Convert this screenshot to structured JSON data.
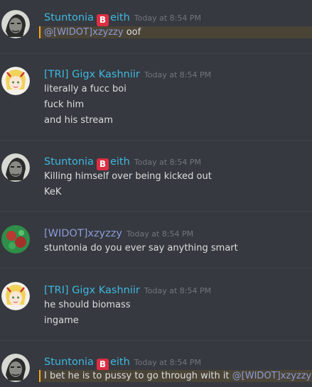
{
  "messages": [
    {
      "author": "Stuntonia",
      "author_suffix": "eith",
      "badge": "B",
      "name_color": "#3fb8e0",
      "timestamp": "Today at 8:54 PM",
      "avatar": "gritty-face-avatar",
      "lines": [
        {
          "mention": "@[WIDOT]xzyzzy",
          "text": " oof",
          "highlight": true
        }
      ]
    },
    {
      "author": "[TRI] Gigx Kashniir",
      "name_color": "#3fb8e0",
      "timestamp": "Today at 8:54 PM",
      "avatar": "anime-girl-avatar",
      "lines": [
        {
          "text": "literally a fucc boi"
        },
        {
          "text": "fuck him"
        },
        {
          "text": "and his stream"
        }
      ]
    },
    {
      "author": "Stuntonia",
      "author_suffix": "eith",
      "badge": "B",
      "name_color": "#3fb8e0",
      "timestamp": "Today at 8:54 PM",
      "avatar": "gritty-face-avatar",
      "lines": [
        {
          "text": "Killing himself over being kicked out"
        },
        {
          "text": "KeK"
        }
      ]
    },
    {
      "author": "[WIDOT]xzyzzy",
      "name_color": "#8b9bd9",
      "timestamp": "Today at 8:54 PM",
      "avatar": "green-red-avatar",
      "lines": [
        {
          "text": "stuntonia do you ever say anything smart"
        }
      ]
    },
    {
      "author": "[TRI] Gigx Kashniir",
      "name_color": "#3fb8e0",
      "timestamp": "Today at 8:54 PM",
      "avatar": "anime-girl-avatar",
      "lines": [
        {
          "text": "he should biomass"
        },
        {
          "text": "ingame"
        }
      ]
    },
    {
      "author": "Stuntonia",
      "author_suffix": "eith",
      "badge": "B",
      "name_color": "#3fb8e0",
      "timestamp": "Today at 8:54 PM",
      "avatar": "gritty-face-avatar",
      "lines": [
        {
          "text": "I bet he is to pussy to go through with it ",
          "mention": "@[WIDOT]xzyzzy",
          "mention_after": true,
          "highlight": true
        }
      ]
    }
  ]
}
